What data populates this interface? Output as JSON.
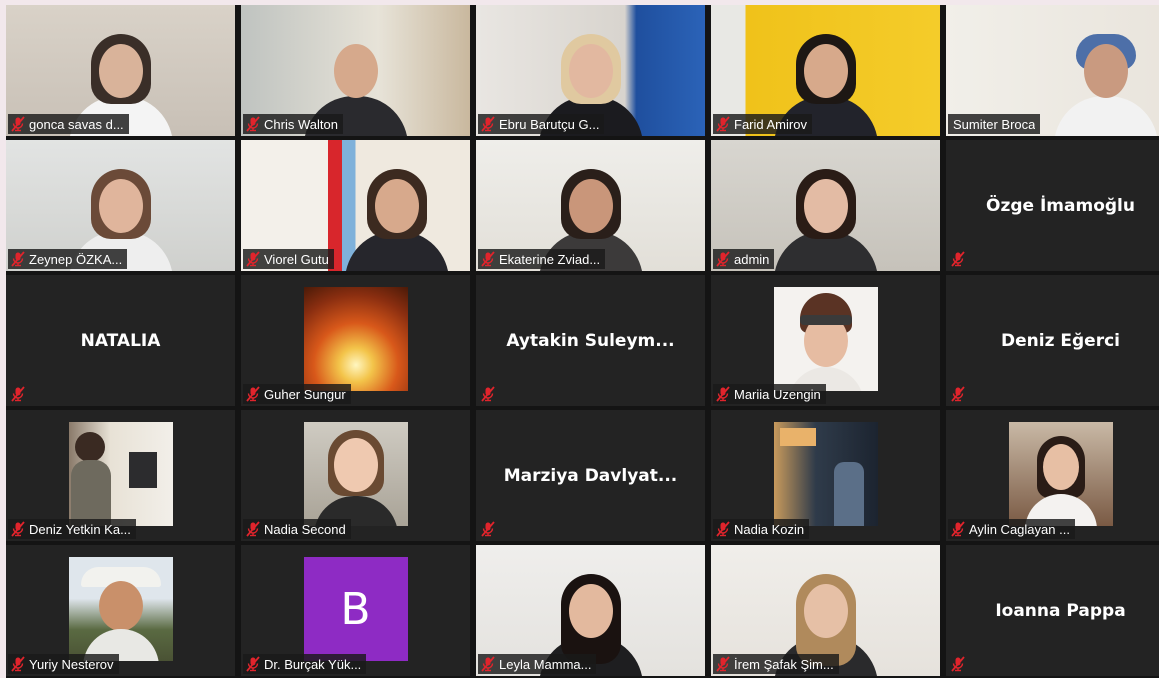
{
  "colors": {
    "background": "#f2e8ec",
    "gallery": "#141414",
    "tile": "#232323",
    "muted_icon": "#e0242c",
    "active_speaker": "#c8e34a",
    "avatar_b": "#8e2bc4"
  },
  "participants": [
    {
      "label": "gonca savas d...",
      "muted": true
    },
    {
      "label": "Chris Walton",
      "muted": true
    },
    {
      "label": "Ebru Barutçu G...",
      "muted": true
    },
    {
      "label": "Farid Amirov",
      "muted": true
    },
    {
      "label": "Sumiter Broca",
      "muted": false
    },
    {
      "label": "Zeynep ÖZKA...",
      "muted": true
    },
    {
      "label": "Viorel Gutu",
      "muted": true
    },
    {
      "label": "Ekaterine Zviad...",
      "muted": true
    },
    {
      "label": "admin",
      "muted": true
    },
    {
      "display_name": "Özge İmamoğlu",
      "muted": true
    },
    {
      "display_name": "NATALIA",
      "muted": true
    },
    {
      "label": "Guher Sungur",
      "muted": true
    },
    {
      "display_name": "Aytakin  Suleym...",
      "muted": true
    },
    {
      "label": "Mariia Uzengin",
      "muted": true
    },
    {
      "display_name": "Deniz Eğerci",
      "muted": true
    },
    {
      "label": "Deniz Yetkin Ka...",
      "muted": true
    },
    {
      "label": "Nadia Second",
      "muted": true
    },
    {
      "display_name": "Marziya  Davlyat...",
      "muted": true
    },
    {
      "label": "Nadia Kozin",
      "muted": true
    },
    {
      "label": "Aylin Caglayan ...",
      "muted": true
    },
    {
      "label": "Yuriy Nesterov",
      "muted": true
    },
    {
      "label": "Dr. Burçak Yük...",
      "muted": true,
      "avatar_letter": "B"
    },
    {
      "label": "Leyla Mamma...",
      "muted": true
    },
    {
      "label": "İrem Şafak Şim...",
      "muted": true,
      "active": true
    },
    {
      "display_name": "Ioanna Pappa",
      "muted": true
    }
  ]
}
